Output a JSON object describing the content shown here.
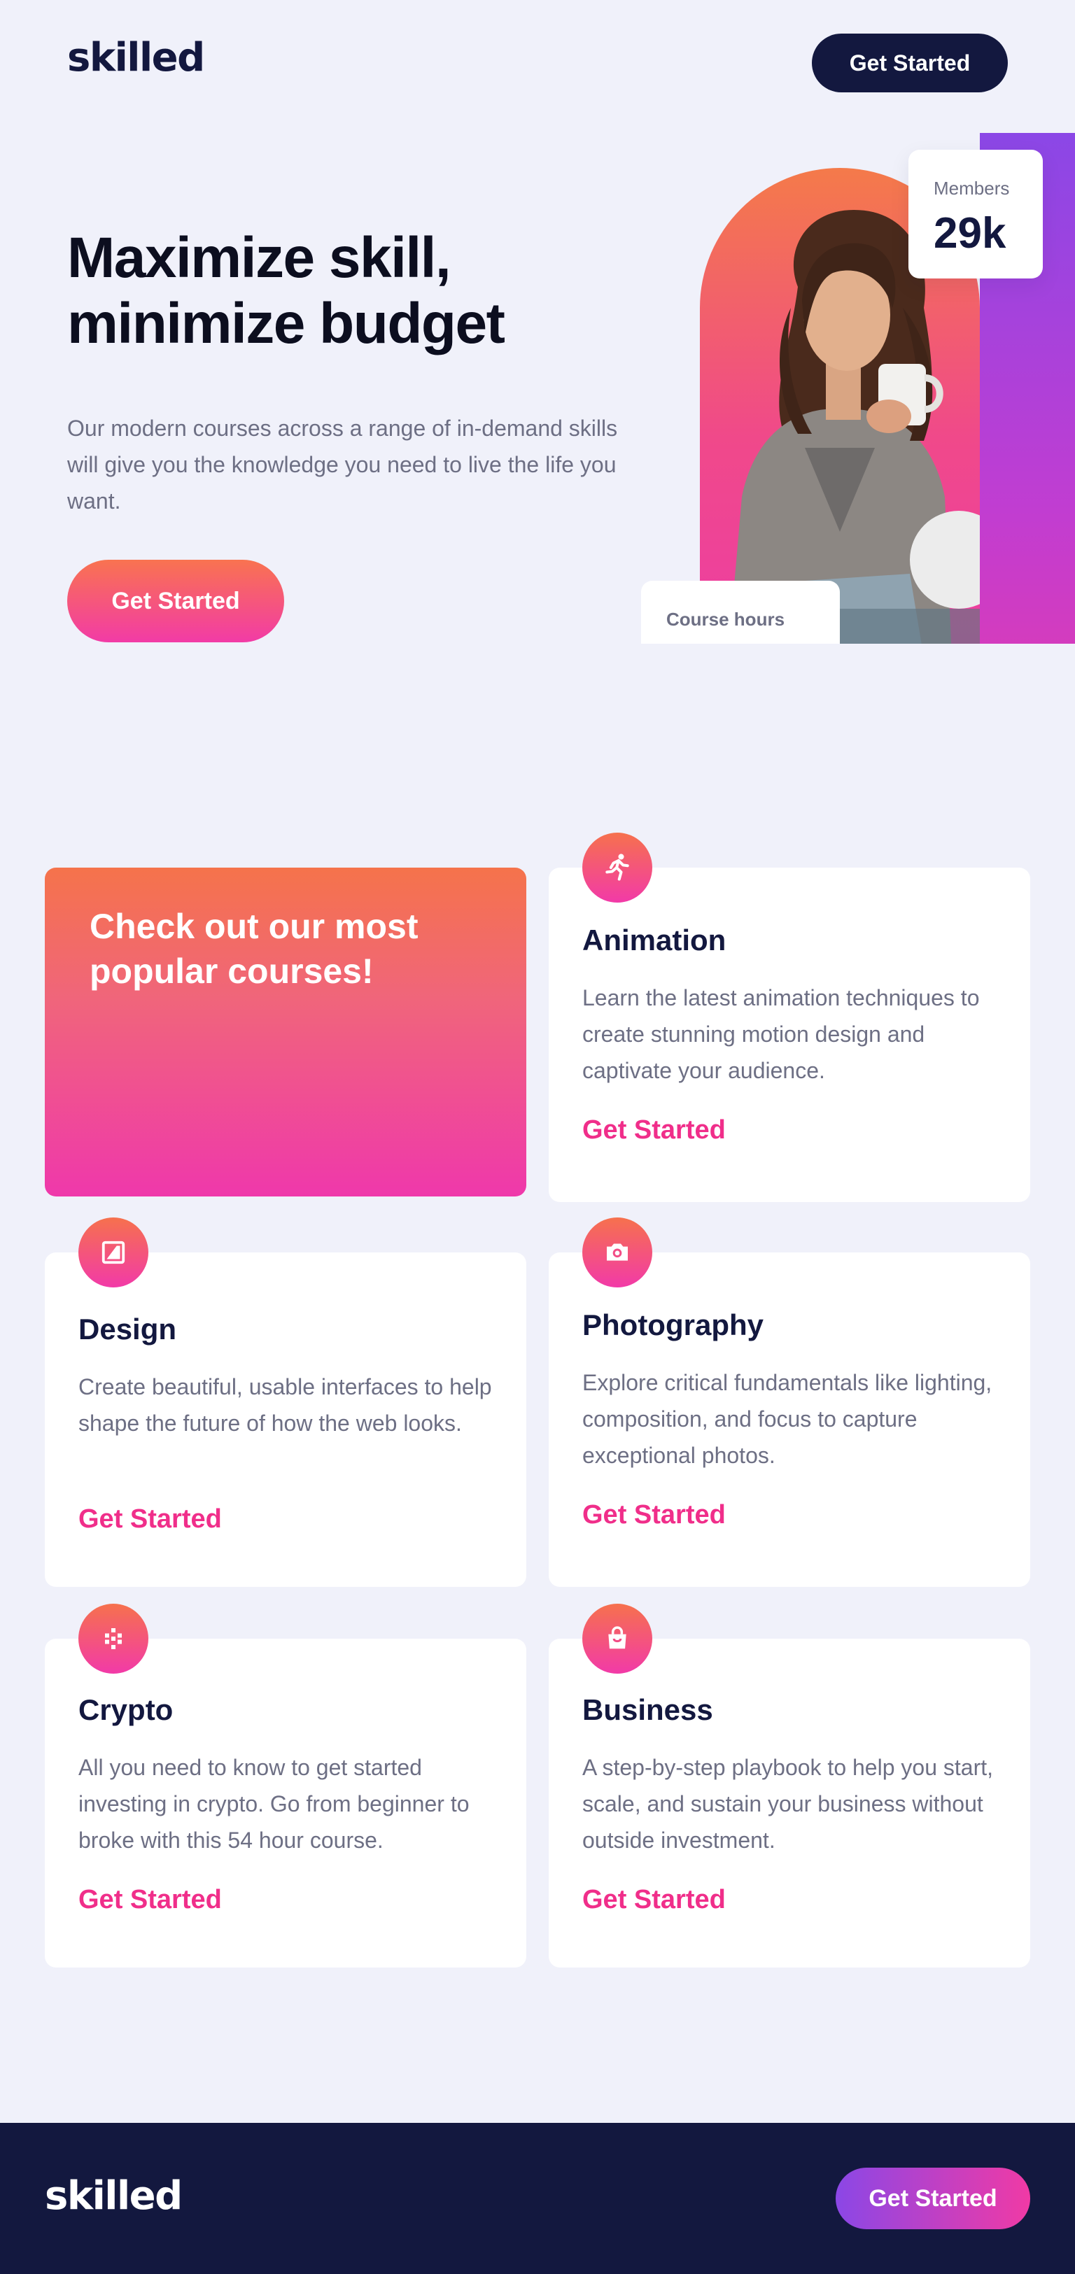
{
  "header": {
    "logo": "skilled",
    "cta_label": "Get Started"
  },
  "hero": {
    "title_line1": "Maximize skill,",
    "title_line2": "minimize budget",
    "text": "Our modern courses across a range of in-demand skills will give you the knowledge you need to live the life you want.",
    "cta_label": "Get Started",
    "members_label": "Members",
    "members_value": "29k",
    "hours_label": "Course hours"
  },
  "courses": {
    "promo_title": "Check out our most popular courses!",
    "items": [
      {
        "icon": "running-figure-icon",
        "title": "Animation",
        "description": "Learn the latest animation techniques to create stunning motion design and captivate your audience.",
        "link": "Get Started"
      },
      {
        "icon": "design-icon",
        "title": "Design",
        "description": "Create beautiful, usable interfaces to help shape the future of how the web looks.",
        "link": "Get Started"
      },
      {
        "icon": "camera-icon",
        "title": "Photography",
        "description": "Explore critical fundamentals like lighting, composition, and focus to capture exceptional photos.",
        "link": "Get Started"
      },
      {
        "icon": "crypto-icon",
        "title": "Crypto",
        "description": "All you need to know to get started investing in crypto. Go from beginner to broke with this 54 hour course.",
        "link": "Get Started"
      },
      {
        "icon": "shopping-bag-icon",
        "title": "Business",
        "description": "A step-by-step playbook to help you start, scale, and sustain your business without outside investment.",
        "link": "Get Started"
      }
    ]
  },
  "footer": {
    "logo": "skilled",
    "cta_label": "Get Started"
  },
  "colors": {
    "navy": "#13183f",
    "pink": "#f02e8a",
    "orange": "#f97350",
    "purple": "#8b47e6",
    "background": "#f0f1fa"
  }
}
